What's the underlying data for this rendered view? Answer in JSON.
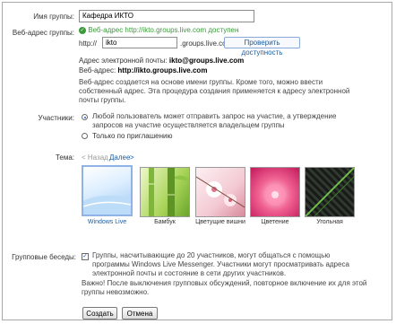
{
  "group_name": {
    "label": "Имя группы:",
    "value": "Кафедра ИКТО"
  },
  "web_address": {
    "label": "Веб-адрес группы:",
    "status": "Веб-адрес http://ikto.groups.live.com доступен",
    "prefix": "http://",
    "value": "ikto",
    "suffix": ".groups.live.com",
    "check_button": "Проверить доступность"
  },
  "info": {
    "email_label": "Адрес электронной почты:",
    "email_value": "ikto@groups.live.com",
    "web_label": "Веб-адрес:",
    "web_value": "http://ikto.groups.live.com",
    "note": "Веб-адрес создается на основе имени группы. Кроме того, можно ввести собственный адрес. Эта процедура создания применяется к адресу электронной почты группы."
  },
  "members": {
    "label": "Участники:",
    "options": [
      {
        "label": "Любой пользователь может отправить запрос на участие, а утверждение запросов на участие осуществляется владельцем группы",
        "selected": true
      },
      {
        "label": "Только по приглашению",
        "selected": false
      }
    ]
  },
  "theme": {
    "label": "Тема:",
    "prev": "< Назад",
    "next": "Далее",
    "next_arrow": ">",
    "items": [
      {
        "name": "Windows Live",
        "selected": true
      },
      {
        "name": "Бамбук",
        "selected": false
      },
      {
        "name": "Цветущие вишни",
        "selected": false
      },
      {
        "name": "Цветение",
        "selected": false
      },
      {
        "name": "Угольная",
        "selected": false
      }
    ]
  },
  "group_chat": {
    "label": "Групповые беседы:",
    "checked": true,
    "text": "Группы, насчитывающие до 20 участников, могут общаться с помощью программы Windows Live Messenger. Участники могут просматривать адреса электронной почты и состояние в сети других участников.",
    "warning": "Важно! После выключения групповых обсуждений, повторное включение их для этой группы невозможно."
  },
  "buttons": {
    "create": "Создать",
    "cancel": "Отмена"
  },
  "colors": {
    "link": "#1a5c9e",
    "ok": "#3a9a3a",
    "selected_border": "#8fb3e6"
  }
}
